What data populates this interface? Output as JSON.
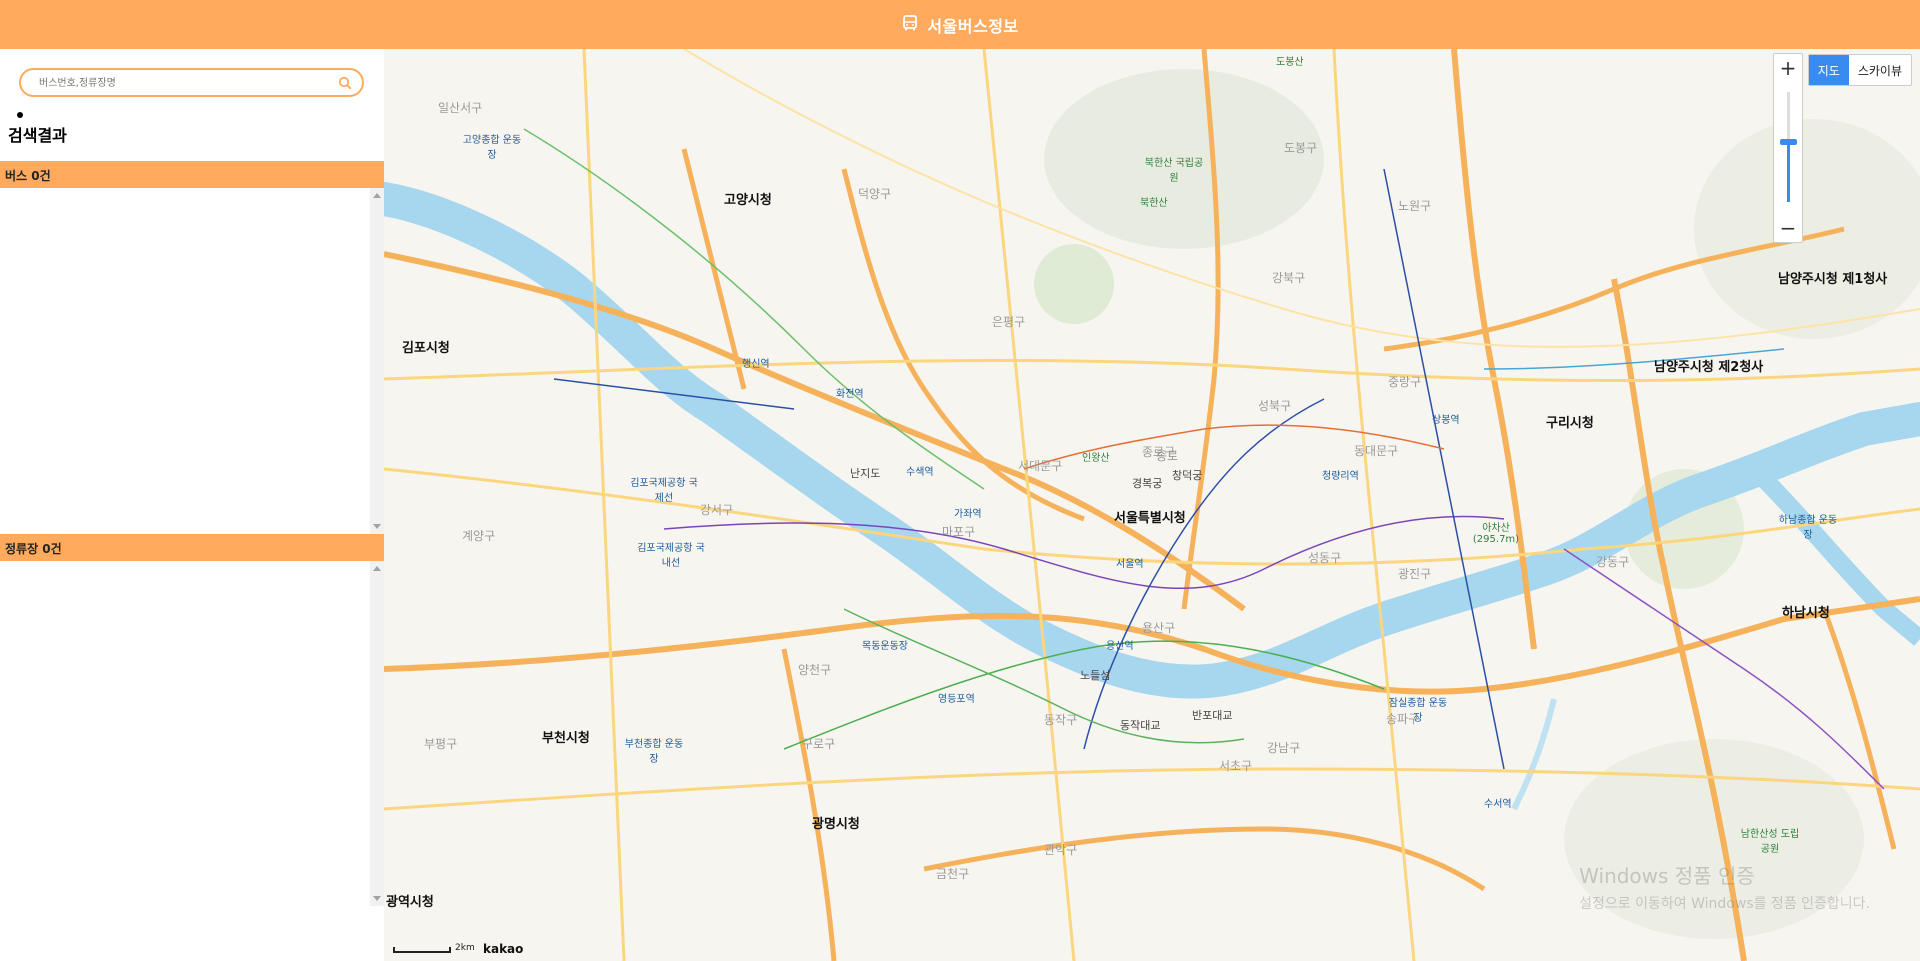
{
  "header": {
    "title": "서울버스정보",
    "icon": "bus-icon",
    "color": "#FFAA5C"
  },
  "sidebar": {
    "search": {
      "placeholder": "버스번호,정류장명",
      "value": ""
    },
    "results_title": "검색결과",
    "bus_section": {
      "label": "버스 0건"
    },
    "stop_section": {
      "label": "정류장 0건"
    }
  },
  "map": {
    "type_controls": {
      "map": "지도",
      "skyview": "스카이뷰",
      "active": "지도"
    },
    "zoom": {
      "plus": "+",
      "minus": "−",
      "level": 0.55
    },
    "scale_label": "2km",
    "brand": "kakao",
    "watermark": {
      "line1": "Windows 정품 인증",
      "line2": "설정으로 이동하여 Windows를 정품 인증합니다."
    },
    "labels": {
      "seoul": "서울특별시청",
      "goyang": "고양시청",
      "gimpo": "김포시청",
      "bucheon": "부천시청",
      "gwangmyeong": "광명시청",
      "guri": "구리시청",
      "hanam": "하남시청",
      "namyangju1": "남양주시청 제1청사",
      "namyangju2": "남양주시청 제2청사",
      "gwangyeok": "광역시청",
      "gimpo_airport": "김포국제공항 국내선",
      "gimpo_intl": "김포국제공항 국제선",
      "gwanaksan": "북한산 국립공원",
      "achasan": "아차산 (295.7m)",
      "jamsil": "잠실종합 운동장",
      "mokdong": "목동운동장",
      "bucheon_stadium": "부천종합 운동장",
      "goyang_stadium": "고양종합 운동장",
      "hanam_stadium": "하남종합 운동장",
      "dobongsan": "도봉산",
      "bukhansan": "북한산",
      "inwangsan": "인왕산",
      "namhansanseong": "남한산성 도립공원",
      "gangnam": "강남구",
      "songpa": "송파구",
      "seocho": "서초구",
      "dongjak": "동작구",
      "guro": "구로구",
      "yangcheon": "양천구",
      "gangseo": "강서구",
      "mapo": "마포구",
      "yongsan": "용산구",
      "seongdong": "성동구",
      "gwangjin": "광진구",
      "gangdong": "강동구",
      "jongno": "종로구",
      "seongbuk": "성북구",
      "dongdaemun": "동대문구",
      "jungnang": "중랑구",
      "nowon": "노원구",
      "dobong": "도봉구",
      "gangbuk": "강북구",
      "eunpyeong": "은평구",
      "seodaemun": "서대문구",
      "deogyang": "덕양구",
      "ilsanseo": "일산서구",
      "gyeyang": "계양구",
      "bupyeong": "부평구",
      "geumcheon": "금천구",
      "gwanak": "관악구",
      "sugu": "수서역",
      "seoul_station": "서울역",
      "yeongdeungpo": "영등포역",
      "yongsan_station": "용산역",
      "cheongnyangni": "청량리역",
      "sangbong": "상봉역",
      "haengsin": "행신역",
      "hwajeon": "화전역",
      "susaek": "수색역",
      "gajwa": "가좌역",
      "nanjido": "난지도",
      "noeul": "노들섬",
      "banpo": "반포대교",
      "dongjak_bridge": "동작대교",
      "gyeongbok": "경복궁",
      "changdeok": "창덕궁",
      "jongno_label": "종로"
    }
  }
}
